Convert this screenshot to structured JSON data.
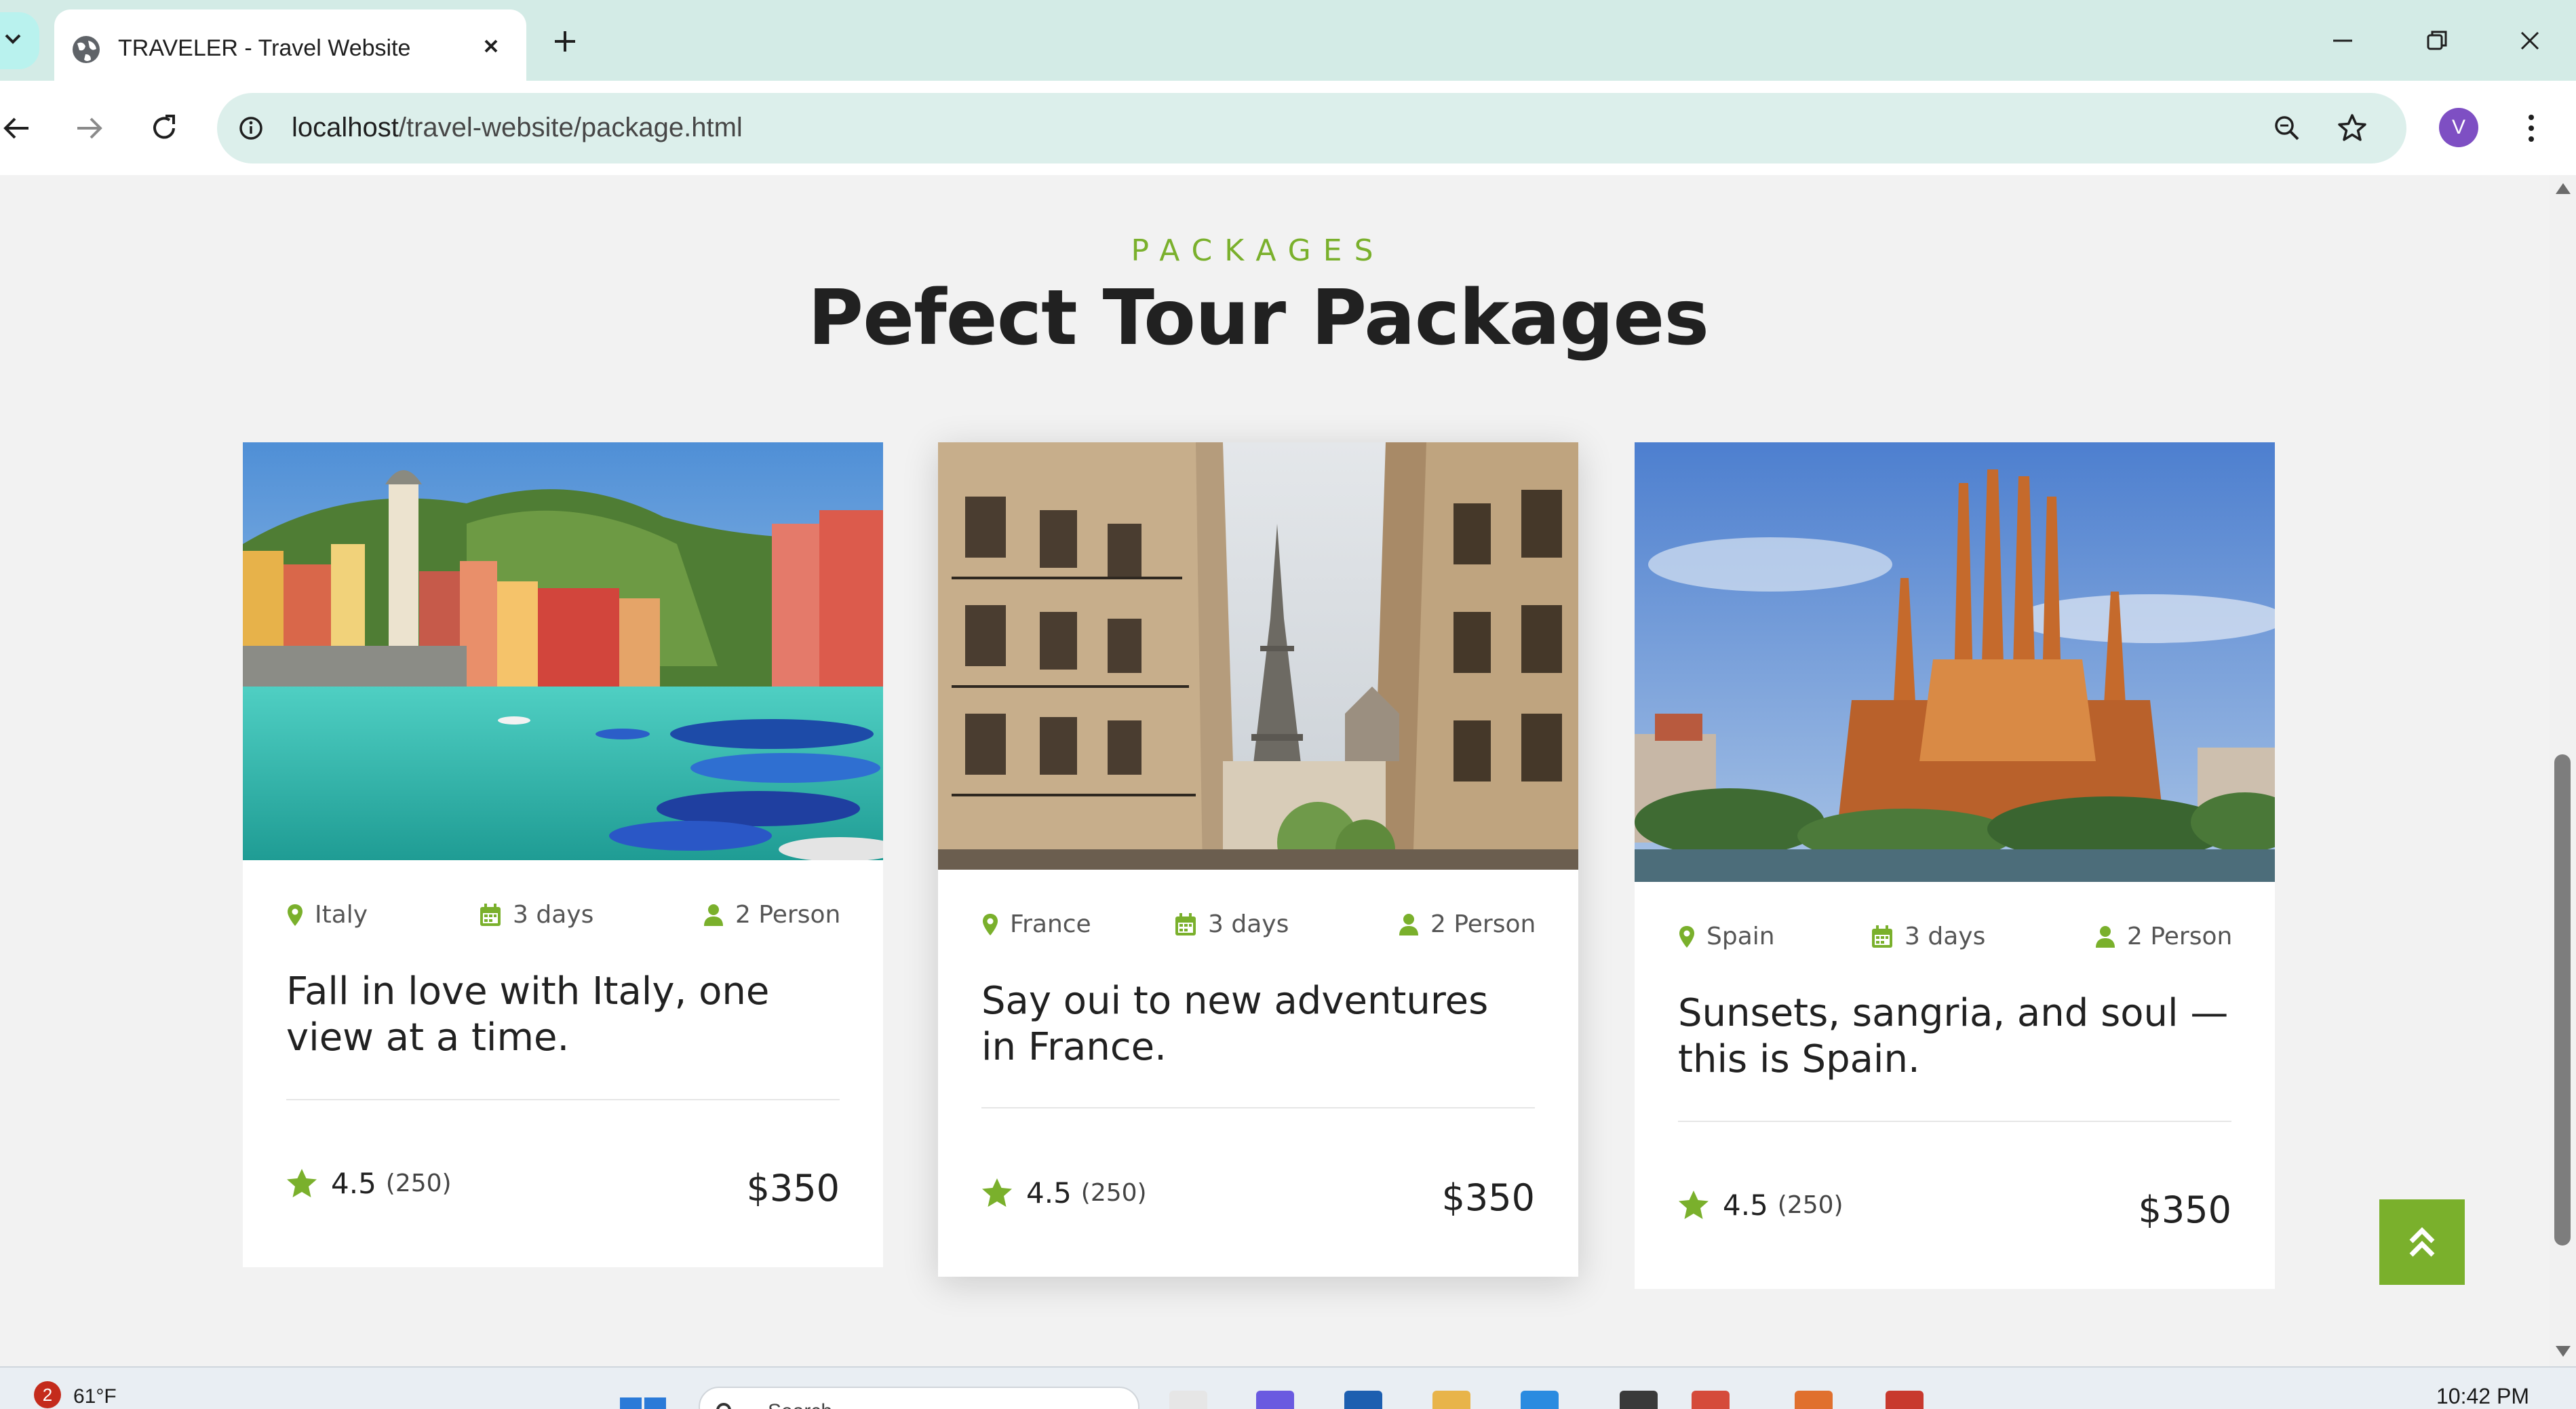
{
  "browser": {
    "tab_title": "TRAVELER - Travel Website",
    "url_host": "localhost",
    "url_path": "/travel-website/package.html",
    "profile_initial": "V"
  },
  "section": {
    "eyebrow": "PACKAGES",
    "heading": "Pefect Tour Packages"
  },
  "packages": [
    {
      "location": "Italy",
      "duration": "3 days",
      "people": "2 Person",
      "title": "Fall in love with Italy, one view at a time.",
      "rating": "4.5",
      "reviews": "(250)",
      "price": "$350",
      "image": "cinque-terre-harbor"
    },
    {
      "location": "France",
      "duration": "3 days",
      "people": "2 Person",
      "title": "Say oui to new adventures in France.",
      "rating": "4.5",
      "reviews": "(250)",
      "price": "$350",
      "image": "paris-street-eiffel-tower"
    },
    {
      "location": "Spain",
      "duration": "3 days",
      "people": "2 Person",
      "title": "Sunsets, sangria, and soul — this is Spain.",
      "rating": "4.5",
      "reviews": "(250)",
      "price": "$350",
      "image": "sagrada-familia"
    }
  ],
  "taskbar": {
    "weather_badge": "2",
    "temperature": "61°F",
    "search_label": "Search",
    "time": "10:42 PM"
  },
  "colors": {
    "accent": "#7ab02c",
    "text": "#212121",
    "background": "#f2f2f2",
    "chrome_tabstrip": "#d3ebe6",
    "omnibox": "#dcefeb"
  },
  "icons": [
    "tab-search-icon",
    "globe-icon",
    "close-icon",
    "plus-icon",
    "minimize-icon",
    "restore-icon",
    "back-icon",
    "forward-icon",
    "reload-icon",
    "site-info-icon",
    "zoom-icon",
    "bookmark-star-icon",
    "more-icon",
    "map-pin-icon",
    "calendar-icon",
    "person-icon",
    "star-icon",
    "double-chevron-up-icon"
  ]
}
